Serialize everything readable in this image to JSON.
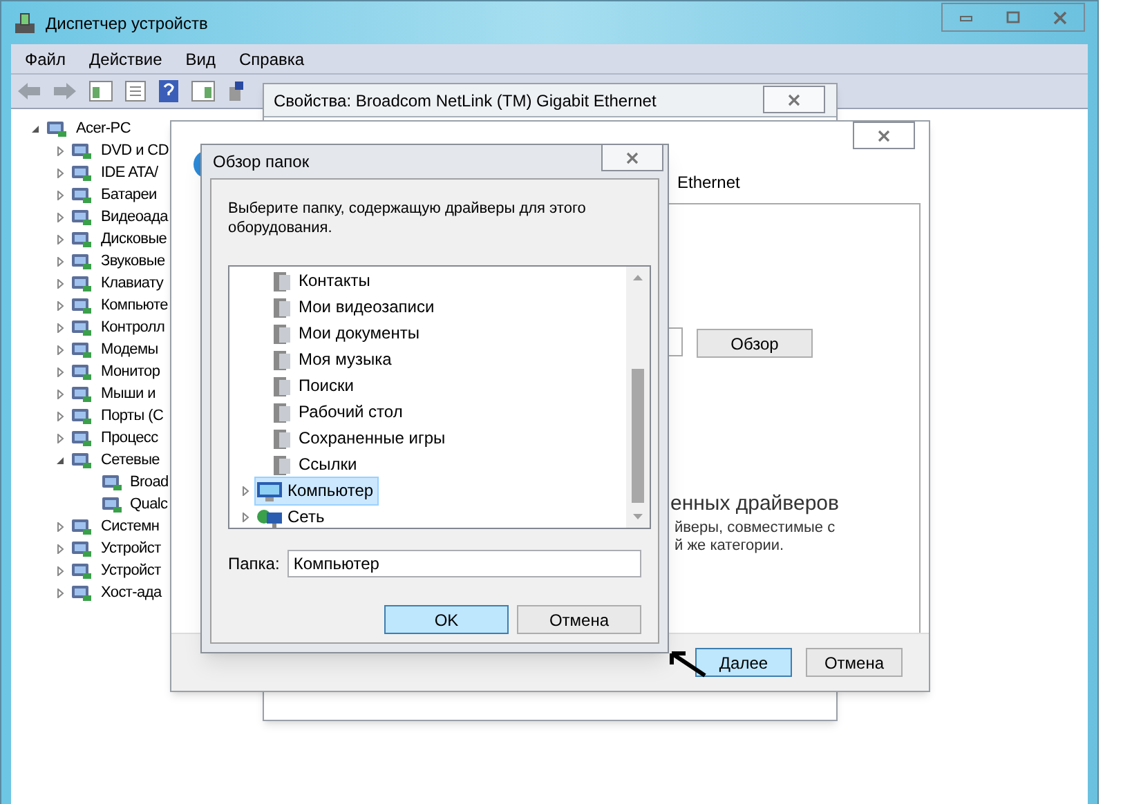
{
  "main_window": {
    "title": "Диспетчер устройств",
    "menu": [
      "Файл",
      "Действие",
      "Вид",
      "Справка"
    ],
    "tree": {
      "label": "Acer-PC",
      "expanded": true,
      "children": [
        {
          "label": "DVD и CD",
          "expanded": false
        },
        {
          "label": "IDE ATA/",
          "expanded": false
        },
        {
          "label": "Батареи",
          "expanded": false
        },
        {
          "label": "Видеоада",
          "expanded": false
        },
        {
          "label": "Дисковые",
          "expanded": false
        },
        {
          "label": "Звуковые",
          "expanded": false
        },
        {
          "label": "Клавиату",
          "expanded": false
        },
        {
          "label": "Компьюте",
          "expanded": false
        },
        {
          "label": "Контролл",
          "expanded": false
        },
        {
          "label": "Модемы",
          "expanded": false
        },
        {
          "label": "Монитор",
          "expanded": false
        },
        {
          "label": "Мыши и",
          "expanded": false
        },
        {
          "label": "Порты (С",
          "expanded": false
        },
        {
          "label": "Процесс",
          "expanded": false
        },
        {
          "label": "Сетевые",
          "expanded": true,
          "children": [
            {
              "label": "Broad"
            },
            {
              "label": "Qualc"
            }
          ]
        },
        {
          "label": "Системн",
          "expanded": false
        },
        {
          "label": "Устройст",
          "expanded": false
        },
        {
          "label": "Устройст",
          "expanded": false
        },
        {
          "label": "Хост-ада",
          "expanded": false
        }
      ]
    }
  },
  "properties_window": {
    "title": "Свойства: Broadcom NetLink (TM) Gigabit Ethernet"
  },
  "wizard": {
    "title_fragment": "Ethernet",
    "browse_button": "Обзор",
    "heading": "енных драйверов",
    "description_lines": [
      "йверы, совместимые с",
      "й же категории."
    ],
    "buttons": [
      {
        "label": "Далее",
        "selected": true
      },
      {
        "label": "Отмена",
        "selected": false
      }
    ]
  },
  "folder_dialog": {
    "title": "Обзор папок",
    "prompt": "Выберите папку, содержащую драйверы для этого оборудования.",
    "user_folders": [
      {
        "label": "Контакты"
      },
      {
        "label": "Мои видеозаписи"
      },
      {
        "label": "Мои документы"
      },
      {
        "label": "Моя музыка"
      },
      {
        "label": "Поиски"
      },
      {
        "label": "Рабочий стол"
      },
      {
        "label": "Сохраненные игры"
      },
      {
        "label": "Ссылки"
      }
    ],
    "top_items": [
      {
        "label": "Компьютер",
        "kind": "computer",
        "expanded": false,
        "selected": true
      },
      {
        "label": "Сеть",
        "kind": "network",
        "expanded": false,
        "selected": false
      }
    ],
    "folder_label": "Папка:",
    "folder_value": "Компьютер",
    "buttons": [
      {
        "label": "OK",
        "selected": true
      },
      {
        "label": "Отмена",
        "selected": false
      }
    ]
  }
}
